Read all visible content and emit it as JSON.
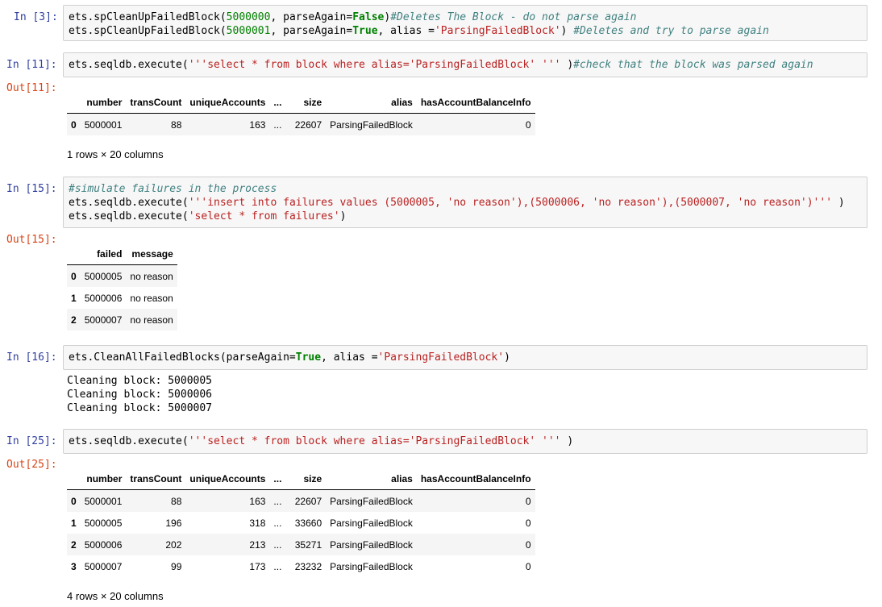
{
  "cells": {
    "c3": {
      "prompt": "In [3]:",
      "line1": [
        "ets.spCleanUpFailedBlock(",
        "5000000",
        ", parseAgain=",
        "False",
        ")",
        "#Deletes The Block - do not parse again"
      ],
      "line2": [
        "ets.spCleanUpFailedBlock(",
        "5000001",
        ", parseAgain=",
        "True",
        ", alias =",
        "'ParsingFailedBlock'",
        ") ",
        "#Deletes and try to parse again"
      ]
    },
    "c11": {
      "prompt": "In [11]:",
      "out_prompt": "Out[11]:",
      "line1": [
        "ets.seqldb.execute(",
        "'''select * from block where alias='ParsingFailedBlock' '''",
        " )",
        "#check that the block was parsed again"
      ],
      "table": {
        "headers": [
          "",
          "number",
          "transCount",
          "uniqueAccounts",
          "...",
          "size",
          "alias",
          "hasAccountBalanceInfo"
        ],
        "rows": [
          [
            "0",
            "5000001",
            "88",
            "163",
            "...",
            "22607",
            "ParsingFailedBlock",
            "0"
          ]
        ]
      },
      "shape": "1 rows × 20 columns"
    },
    "c15": {
      "prompt": "In [15]:",
      "out_prompt": "Out[15]:",
      "line1": "#simulate failures in the process",
      "line2": [
        "ets.seqldb.execute(",
        "'''insert into failures values (5000005, 'no reason'),(5000006, 'no reason'),(5000007, 'no reason')'''",
        " )"
      ],
      "line3": [
        "ets.seqldb.execute(",
        "'select * from failures'",
        ")"
      ],
      "table": {
        "headers": [
          "",
          "failed",
          "message"
        ],
        "rows": [
          [
            "0",
            "5000005",
            "no reason"
          ],
          [
            "1",
            "5000006",
            "no reason"
          ],
          [
            "2",
            "5000007",
            "no reason"
          ]
        ]
      }
    },
    "c16": {
      "prompt": "In [16]:",
      "line1": [
        "ets.CleanAllFailedBlocks(parseAgain=",
        "True",
        ", alias =",
        "'ParsingFailedBlock'",
        ")"
      ],
      "stdout": [
        "Cleaning block: 5000005",
        "Cleaning block: 5000006",
        "Cleaning block: 5000007"
      ]
    },
    "c25": {
      "prompt": "In [25]:",
      "out_prompt": "Out[25]:",
      "line1": [
        "ets.seqldb.execute(",
        "'''select * from block where alias='ParsingFailedBlock' '''",
        " )"
      ],
      "table": {
        "headers": [
          "",
          "number",
          "transCount",
          "uniqueAccounts",
          "...",
          "size",
          "alias",
          "hasAccountBalanceInfo"
        ],
        "rows": [
          [
            "0",
            "5000001",
            "88",
            "163",
            "...",
            "22607",
            "ParsingFailedBlock",
            "0"
          ],
          [
            "1",
            "5000005",
            "196",
            "318",
            "...",
            "33660",
            "ParsingFailedBlock",
            "0"
          ],
          [
            "2",
            "5000006",
            "202",
            "213",
            "...",
            "35271",
            "ParsingFailedBlock",
            "0"
          ],
          [
            "3",
            "5000007",
            "99",
            "173",
            "...",
            "23232",
            "ParsingFailedBlock",
            "0"
          ]
        ]
      },
      "shape": "4 rows × 20 columns"
    }
  }
}
